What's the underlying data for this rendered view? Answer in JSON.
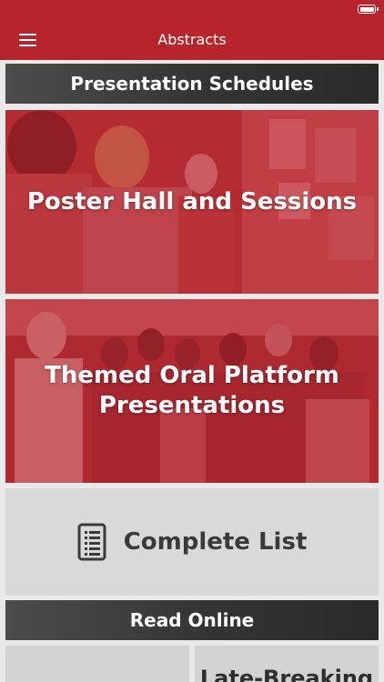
{
  "nav": {
    "title": "Abstracts"
  },
  "sections": {
    "presentation_schedules": "Presentation Schedules",
    "read_online": "Read Online"
  },
  "tiles": {
    "poster_hall": "Poster Hall and Sessions",
    "oral_line1": "Themed Oral Platform",
    "oral_line2": "Presentations",
    "complete_list": "Complete List",
    "late_breaking": "Late-Breaking"
  },
  "colors": {
    "brand_red": "#b8242b",
    "header_dark": "#343434",
    "tile_gray": "#d9d9d9"
  },
  "icons": {
    "menu": "hamburger-icon",
    "list": "document-list-icon",
    "battery": "battery-icon"
  }
}
